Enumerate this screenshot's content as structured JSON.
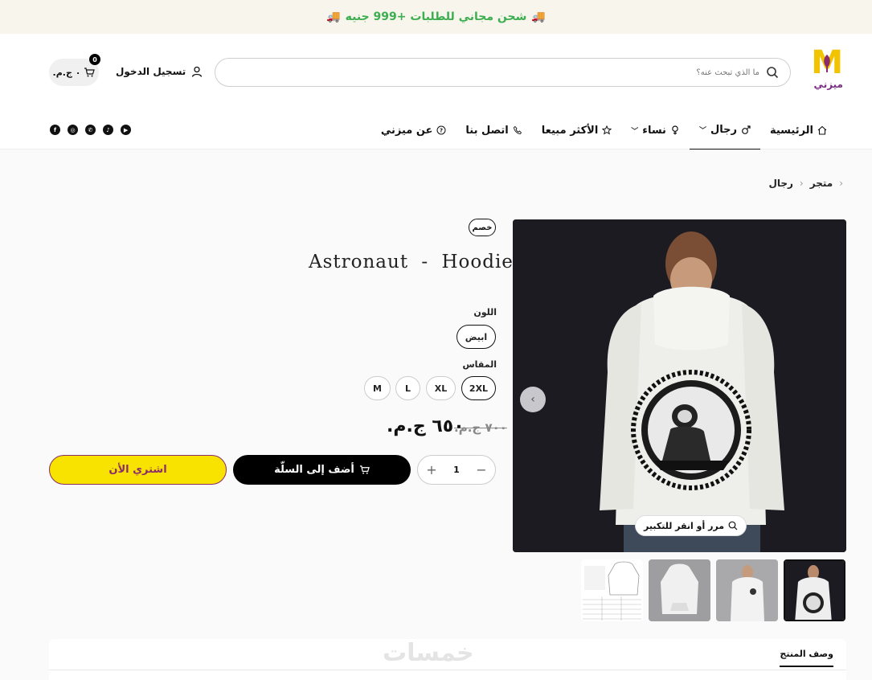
{
  "announcement": {
    "text": "شحن مجاني للطلبات +999 جنيه"
  },
  "brand": {
    "logo_letter": "M",
    "logo_word": "ميزني"
  },
  "search": {
    "placeholder": "ما الذي تبحث عنه؟"
  },
  "account": {
    "login_label": "تسجيل الدخول"
  },
  "cart": {
    "count": "0",
    "total": "٠ ج.م."
  },
  "nav": {
    "items": [
      {
        "label": "الرئيسية",
        "icon": "home-icon"
      },
      {
        "label": "رجال",
        "icon": "male-icon",
        "dropdown": true
      },
      {
        "label": "نساء",
        "icon": "female-icon",
        "dropdown": true
      },
      {
        "label": "الأكثر مبيعا",
        "icon": "star-icon"
      },
      {
        "label": "اتصل بنا",
        "icon": "phone-icon"
      },
      {
        "label": "عن ميزني",
        "icon": "help-icon"
      }
    ]
  },
  "socials": [
    "facebook-icon",
    "instagram-icon",
    "whatsapp-icon",
    "tiktok-icon",
    "youtube-icon"
  ],
  "breadcrumb": {
    "items": [
      "متجر",
      "رجال"
    ]
  },
  "product": {
    "badge": "خصم",
    "title": "Astronaut - Hoodie",
    "color_label": "اللون",
    "color_options": [
      "ابيض"
    ],
    "size_label": "المقاس",
    "size_options": [
      "2XL",
      "XL",
      "L",
      "M"
    ],
    "price_old": "٧٠٠ ج.م.",
    "price_new": "٦٥٠ ج.م.",
    "quantity": "1",
    "add_to_cart": "أضف إلى السلّة",
    "buy_now": "اشتري الأن",
    "zoom_hint": "مرر أو انقر للتكبير"
  },
  "tabs": {
    "description": "وصف المنتج"
  },
  "watermark": "خمسات",
  "colors": {
    "accent_yellow": "#f8e300",
    "brand_purple": "#8a2b6a",
    "announce_green": "#3cae4f"
  }
}
